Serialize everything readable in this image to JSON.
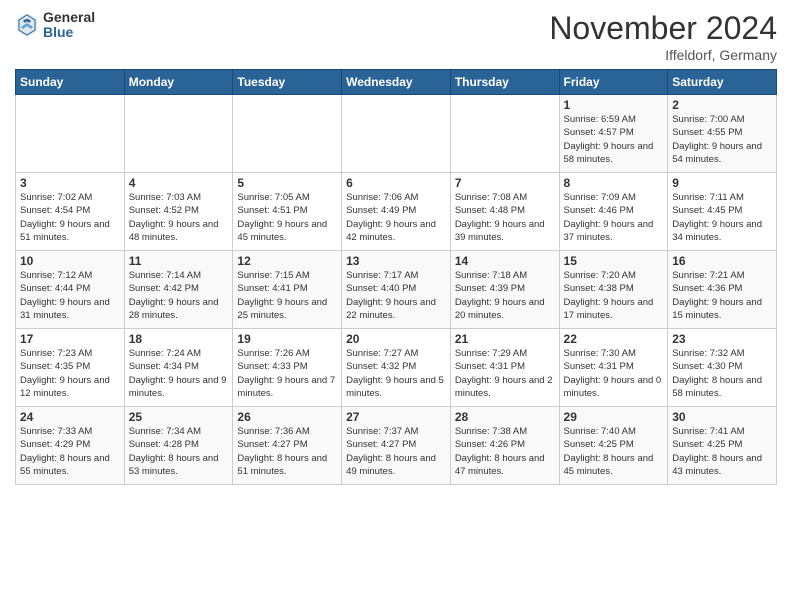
{
  "logo": {
    "general": "General",
    "blue": "Blue"
  },
  "title": "November 2024",
  "location": "Iffeldorf, Germany",
  "days_of_week": [
    "Sunday",
    "Monday",
    "Tuesday",
    "Wednesday",
    "Thursday",
    "Friday",
    "Saturday"
  ],
  "weeks": [
    [
      {
        "day": "",
        "info": ""
      },
      {
        "day": "",
        "info": ""
      },
      {
        "day": "",
        "info": ""
      },
      {
        "day": "",
        "info": ""
      },
      {
        "day": "",
        "info": ""
      },
      {
        "day": "1",
        "info": "Sunrise: 6:59 AM\nSunset: 4:57 PM\nDaylight: 9 hours and 58 minutes."
      },
      {
        "day": "2",
        "info": "Sunrise: 7:00 AM\nSunset: 4:55 PM\nDaylight: 9 hours and 54 minutes."
      }
    ],
    [
      {
        "day": "3",
        "info": "Sunrise: 7:02 AM\nSunset: 4:54 PM\nDaylight: 9 hours and 51 minutes."
      },
      {
        "day": "4",
        "info": "Sunrise: 7:03 AM\nSunset: 4:52 PM\nDaylight: 9 hours and 48 minutes."
      },
      {
        "day": "5",
        "info": "Sunrise: 7:05 AM\nSunset: 4:51 PM\nDaylight: 9 hours and 45 minutes."
      },
      {
        "day": "6",
        "info": "Sunrise: 7:06 AM\nSunset: 4:49 PM\nDaylight: 9 hours and 42 minutes."
      },
      {
        "day": "7",
        "info": "Sunrise: 7:08 AM\nSunset: 4:48 PM\nDaylight: 9 hours and 39 minutes."
      },
      {
        "day": "8",
        "info": "Sunrise: 7:09 AM\nSunset: 4:46 PM\nDaylight: 9 hours and 37 minutes."
      },
      {
        "day": "9",
        "info": "Sunrise: 7:11 AM\nSunset: 4:45 PM\nDaylight: 9 hours and 34 minutes."
      }
    ],
    [
      {
        "day": "10",
        "info": "Sunrise: 7:12 AM\nSunset: 4:44 PM\nDaylight: 9 hours and 31 minutes."
      },
      {
        "day": "11",
        "info": "Sunrise: 7:14 AM\nSunset: 4:42 PM\nDaylight: 9 hours and 28 minutes."
      },
      {
        "day": "12",
        "info": "Sunrise: 7:15 AM\nSunset: 4:41 PM\nDaylight: 9 hours and 25 minutes."
      },
      {
        "day": "13",
        "info": "Sunrise: 7:17 AM\nSunset: 4:40 PM\nDaylight: 9 hours and 22 minutes."
      },
      {
        "day": "14",
        "info": "Sunrise: 7:18 AM\nSunset: 4:39 PM\nDaylight: 9 hours and 20 minutes."
      },
      {
        "day": "15",
        "info": "Sunrise: 7:20 AM\nSunset: 4:38 PM\nDaylight: 9 hours and 17 minutes."
      },
      {
        "day": "16",
        "info": "Sunrise: 7:21 AM\nSunset: 4:36 PM\nDaylight: 9 hours and 15 minutes."
      }
    ],
    [
      {
        "day": "17",
        "info": "Sunrise: 7:23 AM\nSunset: 4:35 PM\nDaylight: 9 hours and 12 minutes."
      },
      {
        "day": "18",
        "info": "Sunrise: 7:24 AM\nSunset: 4:34 PM\nDaylight: 9 hours and 9 minutes."
      },
      {
        "day": "19",
        "info": "Sunrise: 7:26 AM\nSunset: 4:33 PM\nDaylight: 9 hours and 7 minutes."
      },
      {
        "day": "20",
        "info": "Sunrise: 7:27 AM\nSunset: 4:32 PM\nDaylight: 9 hours and 5 minutes."
      },
      {
        "day": "21",
        "info": "Sunrise: 7:29 AM\nSunset: 4:31 PM\nDaylight: 9 hours and 2 minutes."
      },
      {
        "day": "22",
        "info": "Sunrise: 7:30 AM\nSunset: 4:31 PM\nDaylight: 9 hours and 0 minutes."
      },
      {
        "day": "23",
        "info": "Sunrise: 7:32 AM\nSunset: 4:30 PM\nDaylight: 8 hours and 58 minutes."
      }
    ],
    [
      {
        "day": "24",
        "info": "Sunrise: 7:33 AM\nSunset: 4:29 PM\nDaylight: 8 hours and 55 minutes."
      },
      {
        "day": "25",
        "info": "Sunrise: 7:34 AM\nSunset: 4:28 PM\nDaylight: 8 hours and 53 minutes."
      },
      {
        "day": "26",
        "info": "Sunrise: 7:36 AM\nSunset: 4:27 PM\nDaylight: 8 hours and 51 minutes."
      },
      {
        "day": "27",
        "info": "Sunrise: 7:37 AM\nSunset: 4:27 PM\nDaylight: 8 hours and 49 minutes."
      },
      {
        "day": "28",
        "info": "Sunrise: 7:38 AM\nSunset: 4:26 PM\nDaylight: 8 hours and 47 minutes."
      },
      {
        "day": "29",
        "info": "Sunrise: 7:40 AM\nSunset: 4:25 PM\nDaylight: 8 hours and 45 minutes."
      },
      {
        "day": "30",
        "info": "Sunrise: 7:41 AM\nSunset: 4:25 PM\nDaylight: 8 hours and 43 minutes."
      }
    ]
  ]
}
